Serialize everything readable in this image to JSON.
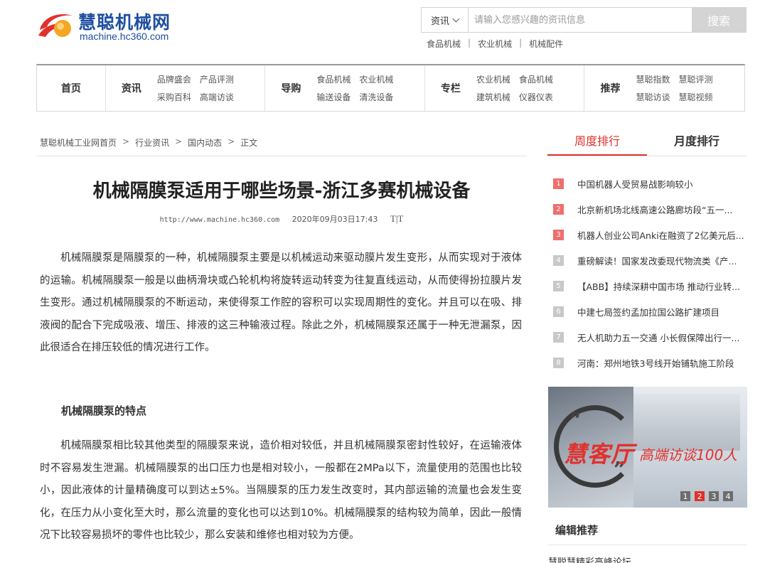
{
  "header": {
    "logo_cn": "慧聪机械网",
    "logo_en": "machine.hc360.com",
    "search": {
      "category": "资讯",
      "placeholder": "请输入您感兴趣的资讯信息",
      "button": "搜索"
    },
    "hot_links": [
      "食品机械",
      "农业机械",
      "机械配件"
    ]
  },
  "nav": {
    "home": "首页",
    "groups": [
      {
        "heading": "资讯",
        "links": [
          "品牌盛会",
          "产品评测",
          "采购百科",
          "高端访谈"
        ]
      },
      {
        "heading": "导购",
        "links": [
          "食品机械",
          "农业机械",
          "输送设备",
          "清洗设备"
        ]
      },
      {
        "heading": "专栏",
        "links": [
          "农业机械",
          "食品机械",
          "建筑机械",
          "仪器仪表"
        ]
      },
      {
        "heading": "推荐",
        "links": [
          "慧聪指数",
          "慧聪评测",
          "慧聪访谈",
          "慧聪视频"
        ]
      }
    ]
  },
  "breadcrumb": [
    "慧聪机械工业网首页",
    "行业资讯",
    "国内动态",
    "正文"
  ],
  "breadcrumb_sep": ">",
  "article": {
    "title": "机械隔膜泵适用于哪些场景-浙江多赛机械设备",
    "url": "http://www.machine.hc360.com",
    "date": "2020年09月03日17:43",
    "font_toggle": "T|T",
    "para1": "机械隔膜泵是隔膜泵的一种，机械隔膜泵主要是以机械运动来驱动膜片发生变形，从而实现对于液体的运输。机械隔膜泵一般是以曲柄滑块或凸轮机构将旋转运动转变为往复直线运动，从而使得扮拉膜片发生变形。通过机械隔膜泵的不断运动，来使得泵工作腔的容积可以实现周期性的变化。并且可以在吸、排液阀的配合下完成吸液、增压、排液的这三种输液过程。除此之外，机械隔膜泵还属于一种无泄漏泵，因此很适合在排压较低的情况进行工作。",
    "subheading": "机械隔膜泵的特点",
    "para2": "机械隔膜泵相比较其他类型的隔膜泵来说，造价相对较低，并且机械隔膜泵密封性较好，在运输液体时不容易发生泄漏。机械隔膜泵的出口压力也是相对较小，一般都在2MPa以下，流量使用的范围也比较小，因此液体的计量精确度可以到达±5%。当隔膜泵的压力发生改变时，其内部运输的流量也会发生变化，在压力从小变化至大时，那么流量的变化也可以达到10%。机械隔膜泵的结构较为简单，因此一般情况下比较容易损坏的零件也比较少，那么安装和维修也相对较为方便。"
  },
  "sidebar": {
    "tabs": [
      "周度排行",
      "月度排行"
    ],
    "ranking": [
      {
        "n": "1",
        "text": "中国机器人受贸易战影响较小"
      },
      {
        "n": "2",
        "text": "北京新机场北线高速公路廊坊段“五一..."
      },
      {
        "n": "3",
        "text": "机器人创业公司Anki在融资了2亿美元后..."
      },
      {
        "n": "4",
        "text": "重磅解读！国家发改委现代物流类《产..."
      },
      {
        "n": "5",
        "text": "【ABB】持续深耕中国市场 推动行业转..."
      },
      {
        "n": "6",
        "text": "中建七局签约孟加拉国公路扩建项目"
      },
      {
        "n": "7",
        "text": "无人机助力五一交通 小长假保障出行一..."
      },
      {
        "n": "8",
        "text": "河南：郑州地铁3号线开始铺轨施工阶段"
      }
    ],
    "banner": {
      "brand": "慧客厅",
      "slogan": "高端访谈100人",
      "pages": [
        "1",
        "2",
        "3",
        "4"
      ],
      "active_page": "2"
    },
    "editor_title": "编辑推荐",
    "editor_first": "慧聪慧精彩高峰论坛"
  },
  "colors": {
    "accent": "#e0312d",
    "brand_blue": "#1e4fa0",
    "rank_hot": "#f06e6e",
    "rank_cold": "#c8c8c8"
  }
}
